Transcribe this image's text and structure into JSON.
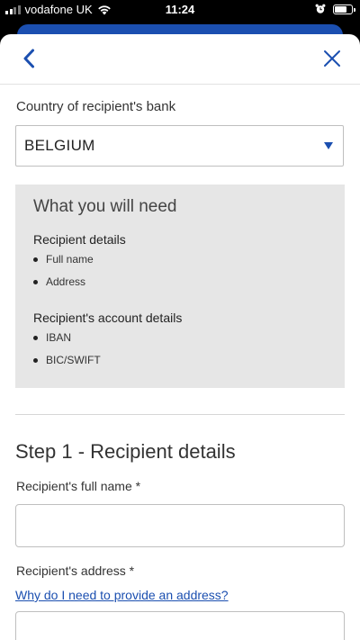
{
  "status_bar": {
    "carrier": "vodafone UK",
    "time": "11:24"
  },
  "header": {
    "back_icon": "chevron-left-icon",
    "close_icon": "close-icon",
    "accent_color": "#1b4fb0"
  },
  "country": {
    "label": "Country of recipient's bank",
    "selected": "BELGIUM"
  },
  "requirements": {
    "title": "What you will need",
    "sections": [
      {
        "heading": "Recipient details",
        "items": [
          "Full name",
          "Address"
        ]
      },
      {
        "heading": "Recipient's account details",
        "items": [
          "IBAN",
          "BIC/SWIFT"
        ]
      }
    ]
  },
  "step1": {
    "title": "Step 1 - Recipient details",
    "full_name_label": "Recipient's full name *",
    "full_name_value": "",
    "address_label": "Recipient's address *",
    "address_help_link": "Why do I need to provide an address?",
    "address_value": ""
  }
}
